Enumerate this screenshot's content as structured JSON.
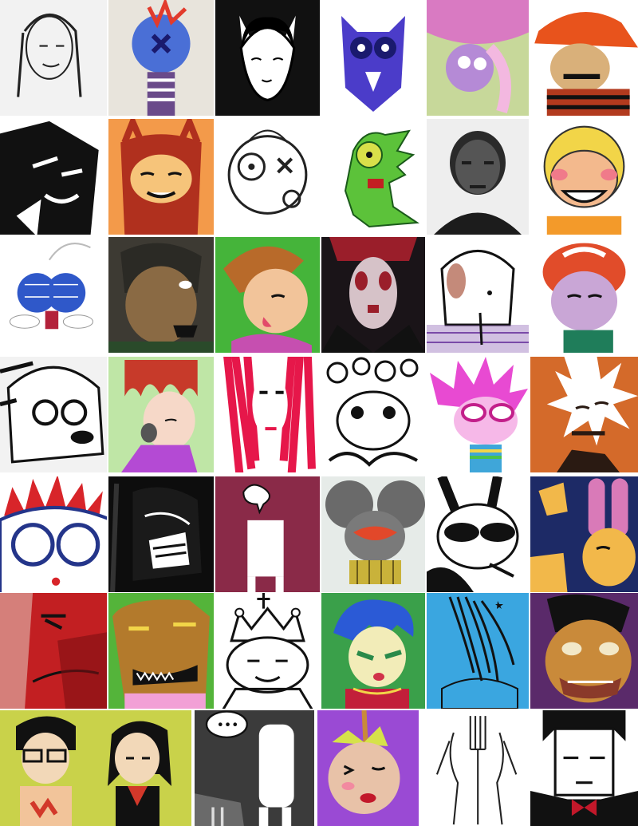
{
  "rows": [
    [
      {
        "name": "sketch-woman-portrait",
        "bg": "#f2f2f2",
        "motif": "sketch-face",
        "fg": "#222222",
        "accent": "#ffffff"
      },
      {
        "name": "plush-doll-photo",
        "bg": "#e8e4dc",
        "motif": "plush",
        "fg": "#4a6fd6",
        "accent": "#e23b2c"
      },
      {
        "name": "bw-bunny-girl",
        "bg": "#111111",
        "motif": "bunny-girl",
        "fg": "#ffffff",
        "accent": "#111111"
      },
      {
        "name": "purple-owl-drawing",
        "bg": "#ffffff",
        "motif": "purple-owl",
        "fg": "#4b3cc9",
        "accent": "#1a1a6e"
      },
      {
        "name": "pink-puppet-photo",
        "bg": "#c7d89a",
        "motif": "puppet",
        "fg": "#d97ac2",
        "accent": "#f3b8e0"
      },
      {
        "name": "orange-hat-character",
        "bg": "#ffffff",
        "motif": "hat-guy",
        "fg": "#e8531c",
        "accent": "#b23a1e"
      }
    ],
    [
      {
        "name": "bw-ink-face",
        "bg": "#ffffff",
        "motif": "ink-face",
        "fg": "#111111",
        "accent": "#444444"
      },
      {
        "name": "red-devil-girl",
        "bg": "#f39a4a",
        "motif": "devil",
        "fg": "#b0301e",
        "accent": "#f6c47a"
      },
      {
        "name": "sketch-x-eye-head",
        "bg": "#ffffff",
        "motif": "x-eye",
        "fg": "#222222",
        "accent": "#ffffff"
      },
      {
        "name": "green-lizard-monster",
        "bg": "#ffffff",
        "motif": "lizard",
        "fg": "#5cc23a",
        "accent": "#d9e04a"
      },
      {
        "name": "dark-charcoal-portrait",
        "bg": "#eeeeee",
        "motif": "charcoal",
        "fg": "#1c1c1c",
        "accent": "#777777"
      },
      {
        "name": "blonde-grinning-boy",
        "bg": "#ffffff",
        "motif": "blonde",
        "fg": "#f2d548",
        "accent": "#f3b98d"
      }
    ],
    [
      {
        "name": "blue-eyed-fly",
        "bg": "#ffffff",
        "motif": "fly",
        "fg": "#2f58c9",
        "accent": "#b3213a"
      },
      {
        "name": "photo-collage-face",
        "bg": "#3d3a33",
        "motif": "photo-face",
        "fg": "#8a6a44",
        "accent": "#2b2a25"
      },
      {
        "name": "green-brown-hair-kid",
        "bg": "#45b43a",
        "motif": "brown-hair",
        "fg": "#b86a2a",
        "accent": "#c64fb0"
      },
      {
        "name": "dark-red-painted-face",
        "bg": "#1a1418",
        "motif": "dark-red",
        "fg": "#9a1e2a",
        "accent": "#d6c2c8"
      },
      {
        "name": "white-dog-sketch",
        "bg": "#ffffff",
        "motif": "dog",
        "fg": "#ffffff",
        "accent": "#7a4aa8"
      },
      {
        "name": "red-hair-sad-boy",
        "bg": "#ffffff",
        "motif": "red-hair",
        "fg": "#e14c2a",
        "accent": "#1f7d5a"
      }
    ],
    [
      {
        "name": "glasses-sketch-face",
        "bg": "#f2f2f2",
        "motif": "glasses-face",
        "fg": "#222222",
        "accent": "#ffffff"
      },
      {
        "name": "pink-girl-red-hair",
        "bg": "#bfe6a6",
        "motif": "pink-girl",
        "fg": "#c73a2a",
        "accent": "#b44ad4"
      },
      {
        "name": "red-hair-white-face",
        "bg": "#ffffff",
        "motif": "red-hair-marker",
        "fg": "#e6174a",
        "accent": "#111111"
      },
      {
        "name": "swirl-cloud-sketch",
        "bg": "#ffffff",
        "motif": "swirls",
        "fg": "#111111",
        "accent": "#ffffff"
      },
      {
        "name": "pink-punk-goggles",
        "bg": "#ffffff",
        "motif": "punk",
        "fg": "#e84ad2",
        "accent": "#3fa6d9"
      },
      {
        "name": "orange-spiky-sketch",
        "bg": "#d46a2a",
        "motif": "spiky",
        "fg": "#ffffff",
        "accent": "#2a1a12"
      }
    ],
    [
      {
        "name": "red-crown-owl-eyes",
        "bg": "#ffffff",
        "motif": "crown-eyes",
        "fg": "#d8252a",
        "accent": "#24358a"
      },
      {
        "name": "black-ink-scream",
        "bg": "#0d0d0d",
        "motif": "ink-scream",
        "fg": "#ffffff",
        "accent": "#333333"
      },
      {
        "name": "maroon-speech-figure",
        "bg": "#8a2a48",
        "motif": "speech-figure",
        "fg": "#ffffff",
        "accent": "#111111"
      },
      {
        "name": "teal-mouse-robot",
        "bg": "#e6ebe8",
        "motif": "mouse",
        "fg": "#3a3a3a",
        "accent": "#e2482a"
      },
      {
        "name": "sunglasses-bunny",
        "bg": "#ffffff",
        "motif": "sun-bunny",
        "fg": "#111111",
        "accent": "#ffffff"
      },
      {
        "name": "navy-bunny-ears",
        "bg": "#1d2a66",
        "motif": "navy-bunny",
        "fg": "#f2b84a",
        "accent": "#d94aa0"
      }
    ],
    [
      {
        "name": "red-abstract-painting",
        "bg": "#c21f22",
        "motif": "red-abstract",
        "fg": "#7d0f12",
        "accent": "#e8e0d2"
      },
      {
        "name": "brown-block-monster",
        "bg": "#54b43a",
        "motif": "brown-block",
        "fg": "#b37a2c",
        "accent": "#f2a0d6"
      },
      {
        "name": "crown-king-sketch",
        "bg": "#ffffff",
        "motif": "king",
        "fg": "#222222",
        "accent": "#ffffff"
      },
      {
        "name": "blue-hair-green-bg",
        "bg": "#3aa04a",
        "motif": "blue-hair",
        "fg": "#2b5ad6",
        "accent": "#d1324a"
      },
      {
        "name": "blue-scribble-hair",
        "bg": "#3aa6e0",
        "motif": "blue-scribble",
        "fg": "#111111",
        "accent": "#7ac6ef"
      },
      {
        "name": "painted-zombie-face",
        "bg": "#5a2a6a",
        "motif": "zombie",
        "fg": "#c98a3a",
        "accent": "#111111"
      }
    ],
    [
      {
        "name": "couple-on-yellow",
        "bg": "#c9d24a",
        "motif": "couple",
        "fg": "#111111",
        "accent": "#d2382a"
      },
      {
        "name": "dotted-thought-figure",
        "bg": "#3b3b3b",
        "motif": "thought-figure",
        "fg": "#ffffff",
        "accent": "#6a6a6a"
      },
      {
        "name": "purple-hanged-head",
        "bg": "#9a4ad4",
        "motif": "hanged",
        "fg": "#e8c2a8",
        "accent": "#d6e24a"
      },
      {
        "name": "fork-figure-sketch",
        "bg": "#ffffff",
        "motif": "fork",
        "fg": "#222222",
        "accent": "#ffffff"
      },
      {
        "name": "bow-tie-vampire",
        "bg": "#ffffff",
        "motif": "vampire",
        "fg": "#111111",
        "accent": "#c2182a"
      }
    ]
  ]
}
